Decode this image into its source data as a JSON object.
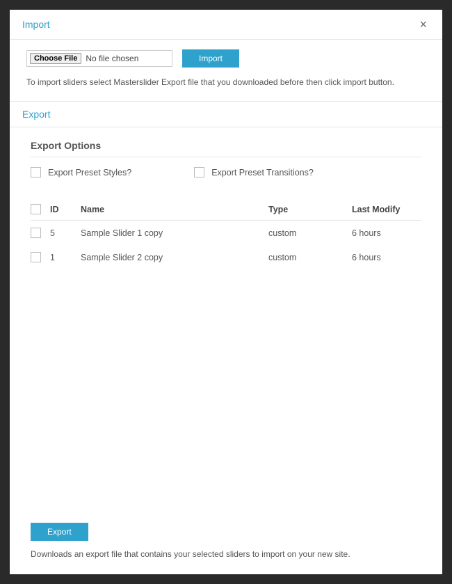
{
  "import": {
    "title": "Import",
    "chooseFileLabel": "Choose File",
    "fileStatus": "No file chosen",
    "importButton": "Import",
    "helpText": "To import sliders select Masterslider Export file that you downloaded before then click import button."
  },
  "export": {
    "title": "Export",
    "optionsTitle": "Export Options",
    "options": {
      "presetStyles": "Export Preset Styles?",
      "presetTransitions": "Export Preset Transitions?"
    },
    "table": {
      "headers": {
        "id": "ID",
        "name": "Name",
        "type": "Type",
        "lastModify": "Last Modify"
      },
      "rows": [
        {
          "id": "5",
          "name": "Sample Slider 1 copy",
          "type": "custom",
          "lastModify": "6 hours"
        },
        {
          "id": "1",
          "name": "Sample Slider 2 copy",
          "type": "custom",
          "lastModify": "6 hours"
        }
      ]
    },
    "exportButton": "Export",
    "helpText": "Downloads an export file that contains your selected sliders to import on your new site."
  },
  "colors": {
    "accent": "#2ea2cc"
  }
}
